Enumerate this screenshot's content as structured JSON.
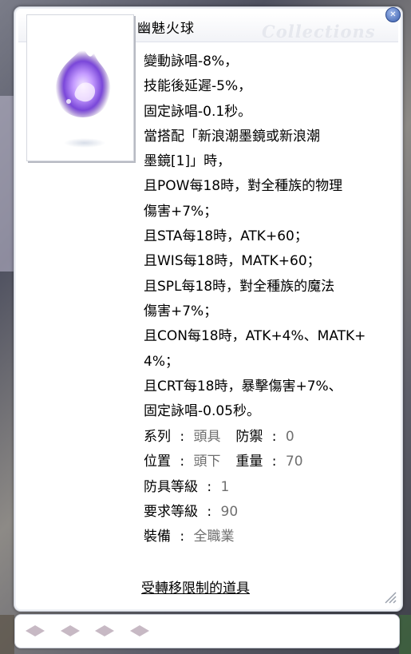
{
  "window": {
    "title": "幽魅火球",
    "watermark": "Collections",
    "close_icon": "close-icon"
  },
  "description": [
    "變動詠唱-8%，",
    "技能後延遲-5%，",
    "固定詠唱-0.1秒。",
    "當搭配「新浪潮墨鏡或新浪潮",
    "墨鏡[1]」時，",
    "且POW每18時，對全種族的物理",
    "傷害+7%；",
    "且STA每18時，ATK+60；",
    "且WIS每18時，MATK+60；",
    "且SPL每18時，對全種族的魔法",
    "傷害+7%；",
    "且CON每18時，ATK+4%、MATK+",
    "4%；",
    "且CRT每18時，暴擊傷害+7%、",
    "固定詠唱-0.05秒。"
  ],
  "properties": {
    "series_label": "系列",
    "series_value": "頭具",
    "defense_label": "防禦",
    "defense_value": "0",
    "location_label": "位置",
    "location_value": "頭下",
    "weight_label": "重量",
    "weight_value": "70",
    "armor_level_label": "防具等級",
    "armor_level_value": "1",
    "required_level_label": "要求等級",
    "required_level_value": "90",
    "equip_label": "裝備",
    "equip_value": "全職業",
    "colon": ":"
  },
  "restriction_text": "受轉移限制的道具",
  "card_slots": {
    "count": 4,
    "icon": "empty-card-slot-icon"
  },
  "colors": {
    "value_gray": "#6f6f6f",
    "border": "#c9cdd6",
    "slot": "#c7b9c4"
  }
}
